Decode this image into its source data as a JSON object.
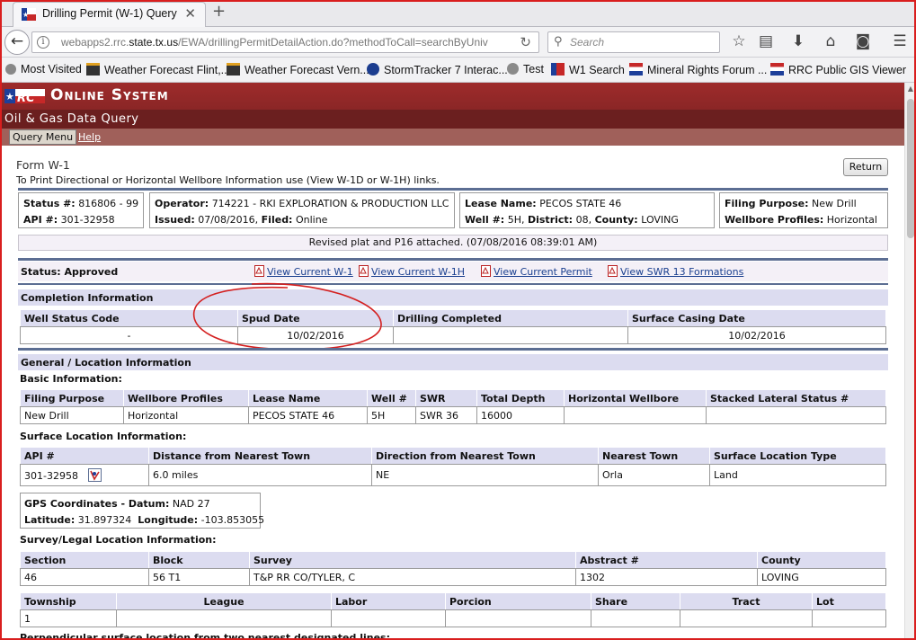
{
  "browser": {
    "tab_title": "Drilling Permit (W-1) Query",
    "url_prefix": "webapps2.rrc.",
    "url_domain": "state.tx.us",
    "url_rest": "/EWA/drillingPermitDetailAction.do?methodToCall=searchByUniv",
    "search_placeholder": "Search",
    "bookmarks": [
      "Most Visited",
      "Weather Forecast Flint,...",
      "Weather Forecast Vern...",
      "StormTracker 7 Interac...",
      "Test",
      "W1 Search",
      "Mineral Rights Forum ...",
      "RRC Public GIS Viewer"
    ]
  },
  "header": {
    "system_title": "Online System",
    "subtitle": "Oil & Gas Data Query",
    "menu_query": "Query Menu",
    "menu_help": "Help"
  },
  "form": {
    "title": "Form W-1",
    "instructions": "To Print Directional or Horizontal Wellbore Information use (View W-1D or W-1H) links.",
    "return_label": "Return"
  },
  "summary": {
    "status_label": "Status #:",
    "status_value": "816806 - 99",
    "api_label": "API #:",
    "api_value": "301-32958",
    "operator_label": "Operator:",
    "operator_value": "714221 - RKI EXPLORATION & PRODUCTION LLC",
    "issued_label": "Issued:",
    "issued_value": "07/08/2016",
    "filed_label": "Filed:",
    "filed_value": "Online",
    "lease_label": "Lease Name:",
    "lease_value": "PECOS STATE 46",
    "well_label": "Well #:",
    "well_value": "5H",
    "district_label": "District:",
    "district_value": "08",
    "county_label": "County:",
    "county_value": "LOVING",
    "purpose_label": "Filing Purpose:",
    "purpose_value": "New Drill",
    "profiles_label": "Wellbore Profiles:",
    "profiles_value": "Horizontal",
    "revised_note": "Revised plat and P16 attached. (07/08/2016 08:39:01 AM)"
  },
  "status_bar": {
    "status_label": "Status:",
    "status_value": "Approved",
    "links": [
      "View Current W-1",
      "View Current W-1H",
      "View Current Permit",
      "View SWR 13 Formations"
    ]
  },
  "completion": {
    "section_title": "Completion Information",
    "headers": [
      "Well Status Code",
      "Spud Date",
      "Drilling Completed",
      "Surface Casing Date"
    ],
    "row": [
      "-",
      "10/02/2016",
      "",
      "10/02/2016"
    ]
  },
  "general": {
    "section_title": "General / Location Information",
    "basic_title": "Basic Information:",
    "basic_headers": [
      "Filing Purpose",
      "Wellbore Profiles",
      "Lease Name",
      "Well #",
      "SWR",
      "Total Depth",
      "Horizontal Wellbore",
      "Stacked Lateral Status #"
    ],
    "basic_row": [
      "New Drill",
      "Horizontal",
      "PECOS STATE 46",
      "5H",
      "SWR 36",
      "16000",
      "",
      ""
    ],
    "surface_title": "Surface Location Information:",
    "surface_headers": [
      "API #",
      "Distance from Nearest Town",
      "Direction from Nearest Town",
      "Nearest Town",
      "Surface Location Type"
    ],
    "surface_row": [
      "301-32958",
      "6.0 miles",
      "NE",
      "Orla",
      "Land"
    ],
    "gps_title": "GPS Coordinates - Datum:",
    "gps_datum": "NAD 27",
    "lat_label": "Latitude:",
    "lat_value": "31.897324",
    "lon_label": "Longitude:",
    "lon_value": "-103.853055",
    "survey_title": "Survey/Legal Location Information:",
    "survey_headers": [
      "Section",
      "Block",
      "Survey",
      "Abstract #",
      "County"
    ],
    "survey_row": [
      "46",
      "56 T1",
      "T&P RR CO/TYLER, C",
      "1302",
      "LOVING"
    ],
    "township_headers": [
      "Township",
      "League",
      "Labor",
      "Porcion",
      "Share",
      "Tract",
      "Lot"
    ],
    "township_row": [
      "1",
      "",
      "",
      "",
      "",
      "",
      ""
    ],
    "cutoff_text": "Perpendicular surface location from two nearest designated lines:"
  },
  "colors": {
    "banner": "#9e2b2b",
    "subbar": "#6b1f1f",
    "section_bg": "#dcdcf0",
    "rule": "#5c6e93",
    "link": "#1a3f8f",
    "annotation_circle": "#d42020"
  }
}
